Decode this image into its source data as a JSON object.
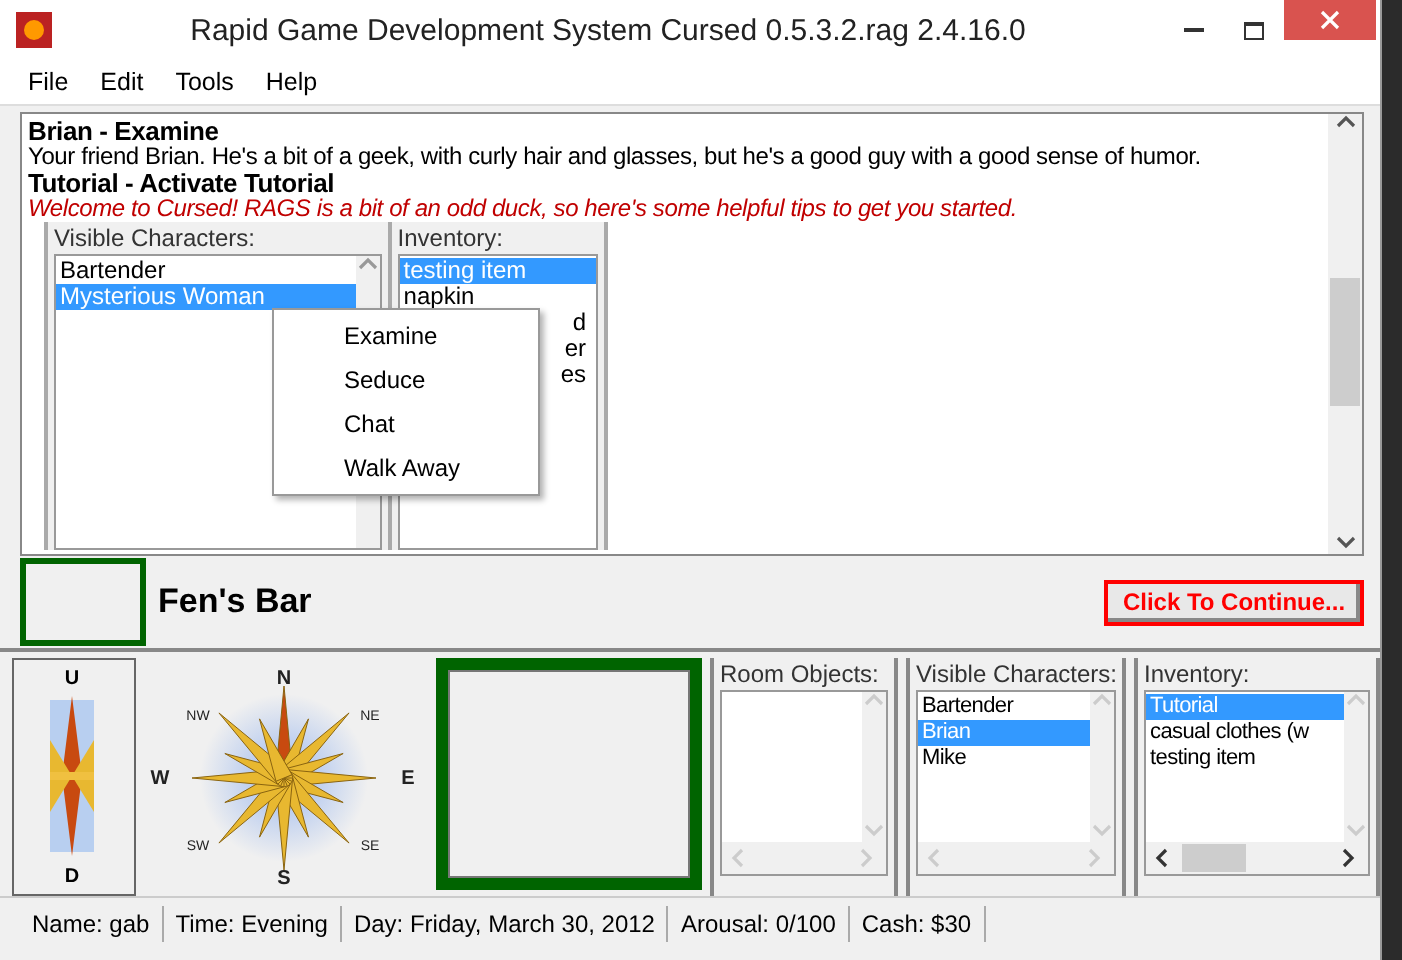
{
  "window": {
    "title": "Rapid Game Development System Cursed 0.5.3.2.rag 2.4.16.0"
  },
  "menu": [
    "File",
    "Edit",
    "Tools",
    "Help"
  ],
  "log": [
    {
      "kind": "heading",
      "text": "Brian - Examine"
    },
    {
      "kind": "body",
      "text": "Your friend Brian. He's a bit of a geek, with curly hair and glasses, but he's a good guy with a good sense of humor."
    },
    {
      "kind": "heading",
      "text": "Tutorial - Activate Tutorial"
    },
    {
      "kind": "note",
      "text": "Welcome to Cursed! RAGS is a bit of an odd duck, so here's some helpful tips to get you started."
    }
  ],
  "log_panels": [
    {
      "label": "Visible Characters:",
      "items": [
        {
          "text": "Bartender",
          "selected": false,
          "kind": "full"
        },
        {
          "text": "Mysterious Woman",
          "selected": true,
          "kind": "full"
        }
      ]
    },
    {
      "label": "Inventory:",
      "items": [
        {
          "text": "testing item",
          "selected": true,
          "kind": "full"
        },
        {
          "text": "napkin",
          "selected": false,
          "kind": "full"
        },
        {
          "text": "d",
          "selected": false,
          "kind": "clipped"
        },
        {
          "text": "er",
          "selected": false,
          "kind": "clipped"
        },
        {
          "text": "es",
          "selected": false,
          "kind": "clipped"
        }
      ]
    }
  ],
  "context_menu": [
    "Examine",
    "Seduce",
    "Chat",
    "Walk Away"
  ],
  "room": {
    "name": "Fen's Bar"
  },
  "continue_button": "Click To Continue...",
  "compass": {
    "up": "U",
    "down": "D",
    "points": [
      "N",
      "NE",
      "E",
      "SE",
      "S",
      "SW",
      "W",
      "NW"
    ]
  },
  "panels": [
    {
      "label": "Room Objects:"
    },
    {
      "label": "Visible Characters:",
      "items": [
        {
          "text": "Bartender",
          "selected": false
        },
        {
          "text": "Brian",
          "selected": true
        },
        {
          "text": "Mike",
          "selected": false
        }
      ]
    },
    {
      "label": "Inventory:",
      "items": [
        {
          "text": "Tutorial",
          "selected": true
        },
        {
          "text": "casual clothes (w",
          "selected": false
        },
        {
          "text": "testing item",
          "selected": false
        }
      ]
    }
  ],
  "status_bar": [
    "Name: gab",
    "Time: Evening",
    "Day: Friday, March 30, 2012",
    "Arousal: 0/100",
    "Cash: $30"
  ]
}
